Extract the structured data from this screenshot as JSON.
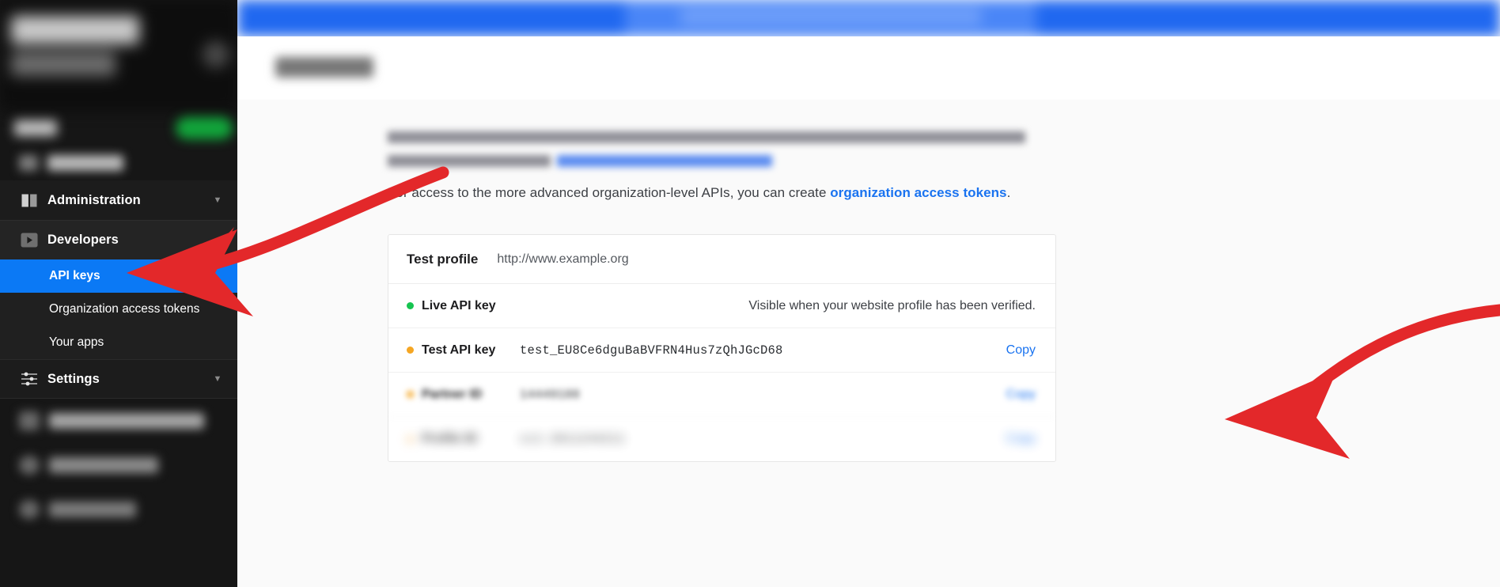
{
  "sidebar": {
    "nav": [
      {
        "id": "administration",
        "label": "Administration",
        "icon": "book-icon",
        "caret": "▼",
        "expanded": false
      },
      {
        "id": "developers",
        "label": "Developers",
        "icon": "play-square-icon",
        "caret": "",
        "expanded": true
      }
    ],
    "developers_subitems": [
      {
        "id": "api-keys",
        "label": "API keys",
        "active": true
      },
      {
        "id": "organization-access-tokens",
        "label": "Organization access tokens",
        "active": false
      },
      {
        "id": "your-apps",
        "label": "Your apps",
        "active": false
      }
    ],
    "settings": {
      "id": "settings",
      "label": "Settings",
      "icon": "sliders-icon",
      "caret": "▼"
    }
  },
  "main": {
    "paragraph_org": {
      "before": "For access to the more advanced organization-level APIs, you can create ",
      "link": "organization access tokens",
      "after": "."
    },
    "card": {
      "profile_title": "Test profile",
      "profile_url": "http://www.example.org",
      "rows": [
        {
          "id": "live-api-key",
          "dot_color": "#16c450",
          "label": "Live API key",
          "value": "",
          "note": "Visible when your website profile has been verified.",
          "action": ""
        },
        {
          "id": "test-api-key",
          "dot_color": "#f5a623",
          "label": "Test API key",
          "value": "test_EU8Ce6dguBaBVFRN4Hus7zQhJGcD68",
          "note": "",
          "action": "Copy"
        },
        {
          "id": "partner-id",
          "dot_color": "#f5a623",
          "label": "Partner ID",
          "value": "14449188",
          "note": "",
          "action": "Copy"
        },
        {
          "id": "extra-key",
          "dot_color": "#f7c98a",
          "label": "Profile ID",
          "value": "cc1-2811244211",
          "note": "",
          "action": "Copy"
        }
      ]
    }
  },
  "colors": {
    "sidebar_bg": "#161616",
    "active_blue": "#0b79f5",
    "link_blue": "#1a73f0",
    "banner_blue": "#2068f0",
    "annotation_red": "#e3282a",
    "status_green": "#16c450",
    "status_amber": "#f5a623"
  }
}
